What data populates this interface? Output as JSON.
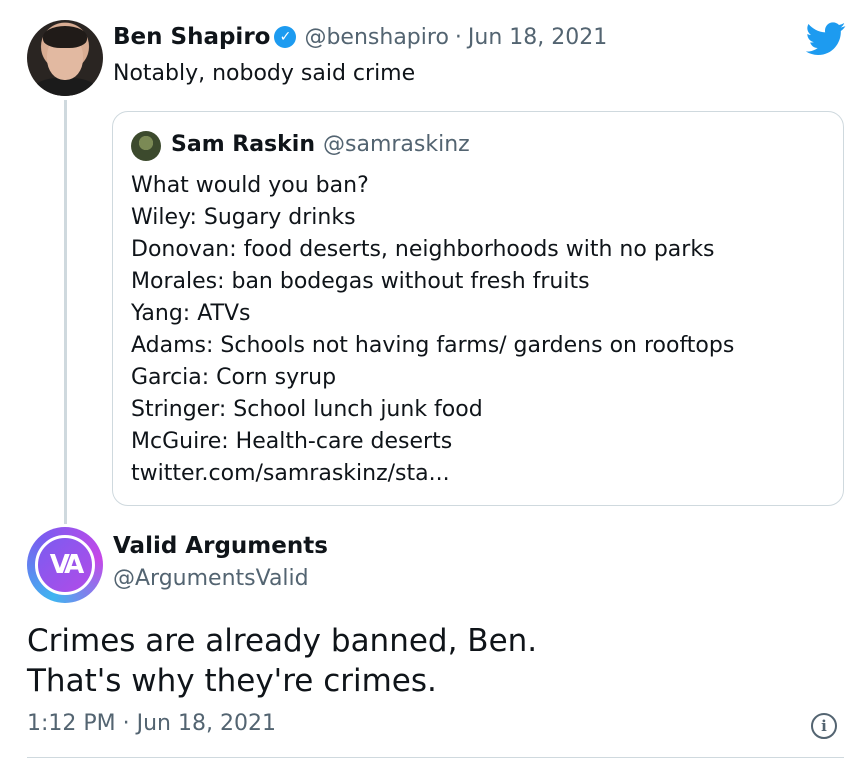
{
  "tweet": {
    "author_name": "Ben Shapiro",
    "author_handle": "@benshapiro",
    "separator": "·",
    "date": "Jun 18, 2021",
    "text": "Notably, nobody said crime",
    "verified_mark": "✓"
  },
  "quote": {
    "author_name": "Sam Raskin",
    "author_handle": "@samraskinz",
    "lines": [
      "What would you ban?",
      "Wiley: Sugary drinks",
      "Donovan: food deserts, neighborhoods with no parks",
      "Morales: ban bodegas without fresh fruits",
      "Yang: ATVs",
      "Adams: Schools not having farms/ gardens on rooftops",
      "Garcia: Corn syrup",
      "Stringer: School lunch junk food",
      "McGuire: Health-care deserts",
      "twitter.com/samraskinz/sta..."
    ]
  },
  "reply": {
    "author_name": "Valid Arguments",
    "author_handle": "@ArgumentsValid",
    "avatar_text": "VA",
    "text_lines": [
      "Crimes are already banned, Ben.",
      "That's why they're crimes."
    ],
    "timestamp": "1:12 PM · Jun 18, 2021",
    "info_glyph": "i"
  },
  "colors": {
    "twitter_blue": "#1d9bf0",
    "muted_text": "#536471",
    "border": "#cfd9de"
  }
}
